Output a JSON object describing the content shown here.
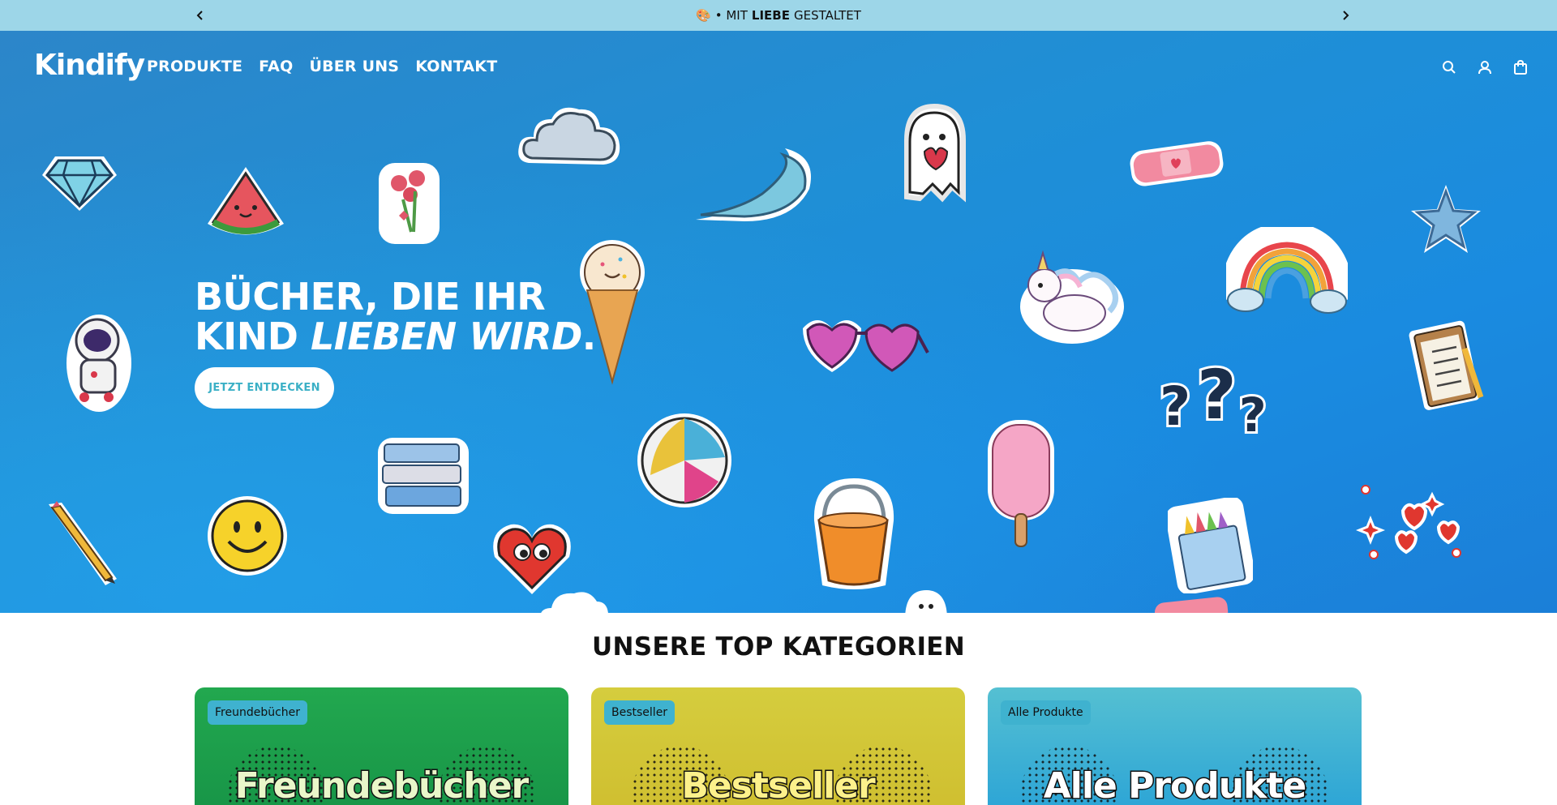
{
  "announcement": {
    "emoji": "🎨",
    "prefix": "• MIT",
    "emphasis": "LIEBE",
    "suffix": "GESTALTET",
    "prev_icon": "chevron-left-icon",
    "next_icon": "chevron-right-icon"
  },
  "header": {
    "logo": "Kindify",
    "nav": [
      "PRODUKTE",
      "FAQ",
      "ÜBER UNS",
      "KONTAKT"
    ],
    "icons": [
      "search-icon",
      "account-icon",
      "cart-icon"
    ]
  },
  "hero": {
    "title_line1": "BÜCHER, DIE IHR",
    "title_line2_plain": "KIND",
    "title_line2_italic": "LIEBEN WIRD",
    "title_line2_end": ".",
    "cta_label": "JETZT ENTDECKEN",
    "stickers": [
      "diamond",
      "watermelon",
      "flowers",
      "cloud",
      "ice-cream",
      "wave",
      "ghost",
      "bandage",
      "star",
      "unicorn",
      "rainbow",
      "sunglasses",
      "clipboard",
      "question-marks",
      "astronaut",
      "books",
      "beach-ball",
      "popsicle",
      "smiley",
      "heart-face",
      "bucket",
      "crayons",
      "hearts",
      "pencil"
    ]
  },
  "categories": {
    "heading": "UNSERE TOP KATEGORIEN",
    "items": [
      {
        "badge": "Freundebücher",
        "title": "Freundebücher"
      },
      {
        "badge": "Bestseller",
        "title": "Bestseller"
      },
      {
        "badge": "Alle Produkte",
        "title": "Alle Produkte"
      }
    ]
  },
  "colors": {
    "announcement_bg": "#9dd6e8",
    "hero_bg": "#1f8fd6",
    "cta_text": "#3bb0c6",
    "badge_bg": "#3fb2cf"
  }
}
